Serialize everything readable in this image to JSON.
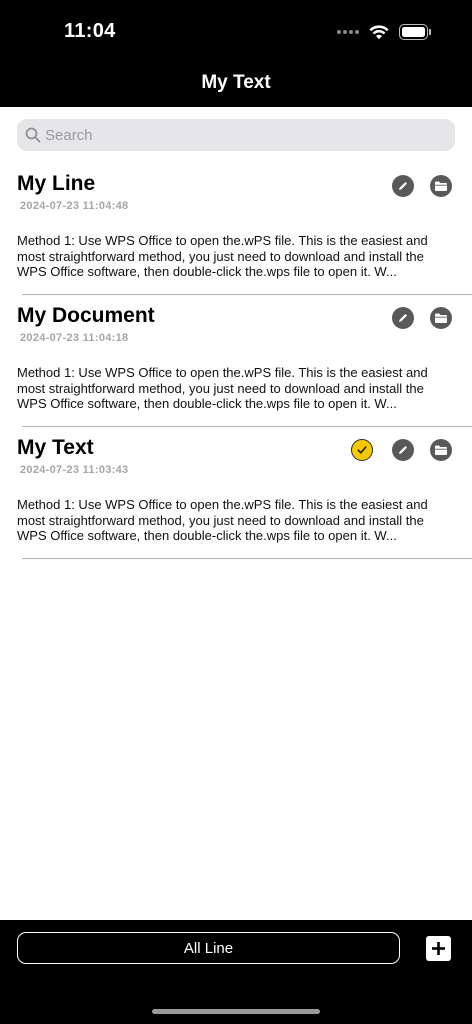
{
  "status_bar": {
    "time": "11:04"
  },
  "nav": {
    "title": "My Text"
  },
  "search": {
    "placeholder": "Search"
  },
  "items": [
    {
      "title": "My Line",
      "date": "2024-07-23 11:04:48",
      "body": "Method 1: Use WPS Office to open the.wPS file. This is the easiest and most straightforward method, you just need to download and install the WPS Office software, then double-click the.wps file to open it. W...",
      "selected": false
    },
    {
      "title": "My Document",
      "date": "2024-07-23 11:04:18",
      "body": "Method 1: Use WPS Office to open the.wPS file. This is the easiest and most straightforward method, you just need to download and install the WPS Office software, then double-click the.wps file to open it. W...",
      "selected": false
    },
    {
      "title": "My Text",
      "date": "2024-07-23 11:03:43",
      "body": "Method 1: Use WPS Office to open the.wPS file. This is the easiest and most straightforward method, you just need to download and install the WPS Office software, then double-click the.wps file to open it. W...",
      "selected": true
    }
  ],
  "bottom_bar": {
    "all_line_label": "All Line"
  },
  "icons": {
    "search": "search-icon",
    "edit": "pencil-icon",
    "folder": "folder-icon",
    "check": "checkmark-icon",
    "add": "plus-icon"
  },
  "colors": {
    "header_bg": "#000000",
    "selected_badge": "#f5c800",
    "action_icon_bg": "#595959",
    "date_text": "#a6a6a6"
  }
}
